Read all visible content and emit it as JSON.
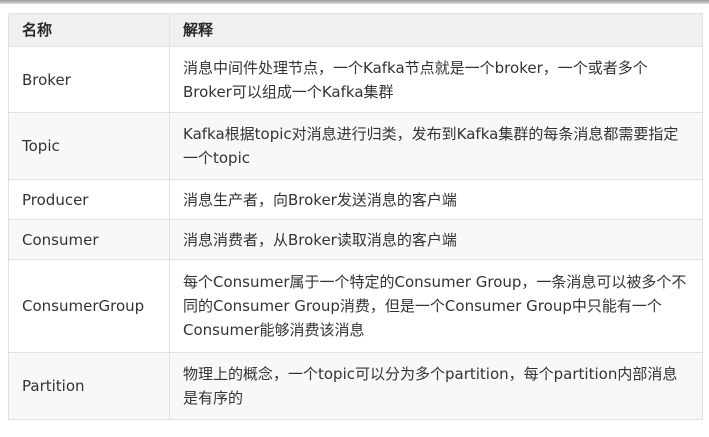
{
  "table": {
    "headers": [
      "名称",
      "解释"
    ],
    "rows": [
      {
        "name": "Broker",
        "desc": "消息中间件处理节点，一个Kafka节点就是一个broker，一个或者多个Broker可以组成一个Kafka集群"
      },
      {
        "name": "Topic",
        "desc": "Kafka根据topic对消息进行归类，发布到Kafka集群的每条消息都需要指定一个topic"
      },
      {
        "name": "Producer",
        "desc": "消息生产者，向Broker发送消息的客户端"
      },
      {
        "name": "Consumer",
        "desc": "消息消费者，从Broker读取消息的客户端"
      },
      {
        "name": "ConsumerGroup",
        "desc": "每个Consumer属于一个特定的Consumer Group，一条消息可以被多个不同的Consumer Group消费，但是一个Consumer Group中只能有一个Consumer能够消费该消息"
      },
      {
        "name": "Partition",
        "desc": "物理上的概念，一个topic可以分为多个partition，每个partition内部消息是有序的"
      }
    ]
  }
}
